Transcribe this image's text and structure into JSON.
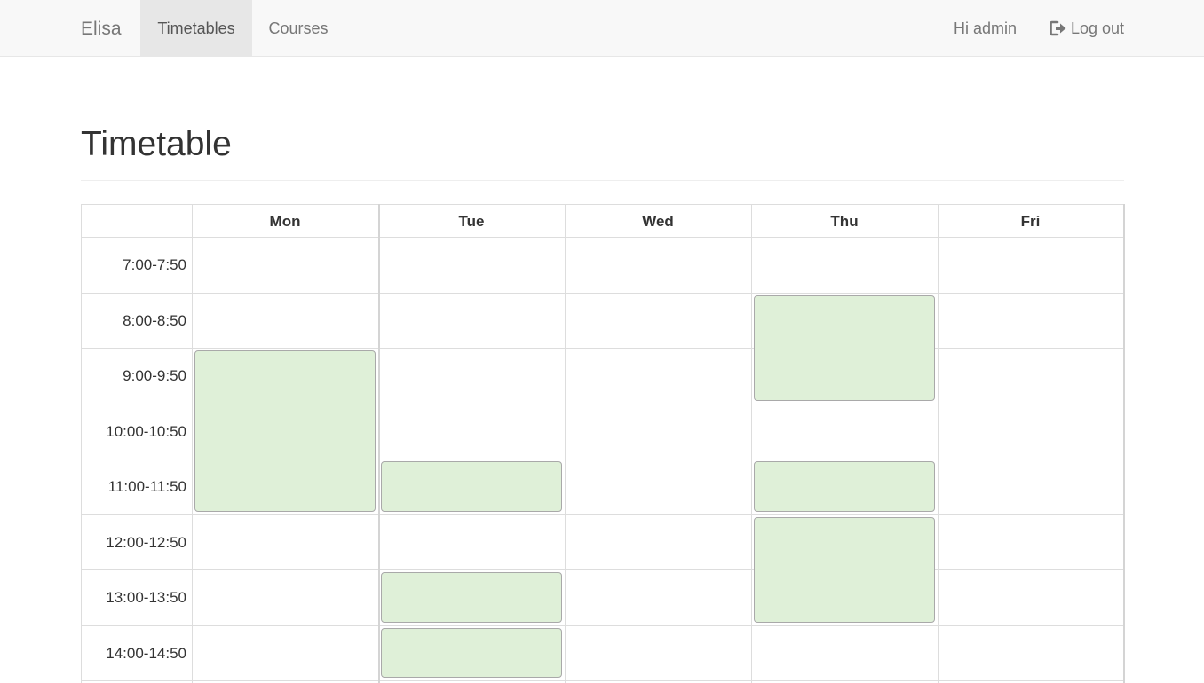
{
  "navbar": {
    "brand": "Elisa",
    "items": [
      {
        "label": "Timetables",
        "active": true
      },
      {
        "label": "Courses",
        "active": false
      }
    ],
    "greeting": "Hi admin",
    "logout_label": "Log out",
    "logout_icon": "sign-out-icon"
  },
  "page": {
    "title": "Timetable"
  },
  "timetable": {
    "days": [
      "Mon",
      "Tue",
      "Wed",
      "Thu",
      "Fri"
    ],
    "slots": [
      "7:00-7:50",
      "8:00-8:50",
      "9:00-9:50",
      "10:00-10:50",
      "11:00-11:50",
      "12:00-12:50",
      "13:00-13:50",
      "14:00-14:50"
    ],
    "events": [
      {
        "day": "Mon",
        "from": "9:00-9:50",
        "to": "11:00-11:50"
      },
      {
        "day": "Tue",
        "from": "11:00-11:50",
        "to": "11:00-11:50"
      },
      {
        "day": "Tue",
        "from": "13:00-13:50",
        "to": "13:00-13:50"
      },
      {
        "day": "Tue",
        "from": "14:00-14:50",
        "to": "14:00-14:50"
      },
      {
        "day": "Thu",
        "from": "8:00-8:50",
        "to": "9:00-9:50"
      },
      {
        "day": "Thu",
        "from": "11:00-11:50",
        "to": "11:00-11:50"
      },
      {
        "day": "Thu",
        "from": "12:00-12:50",
        "to": "13:00-13:50"
      }
    ],
    "event_color": "#dff0d8"
  }
}
